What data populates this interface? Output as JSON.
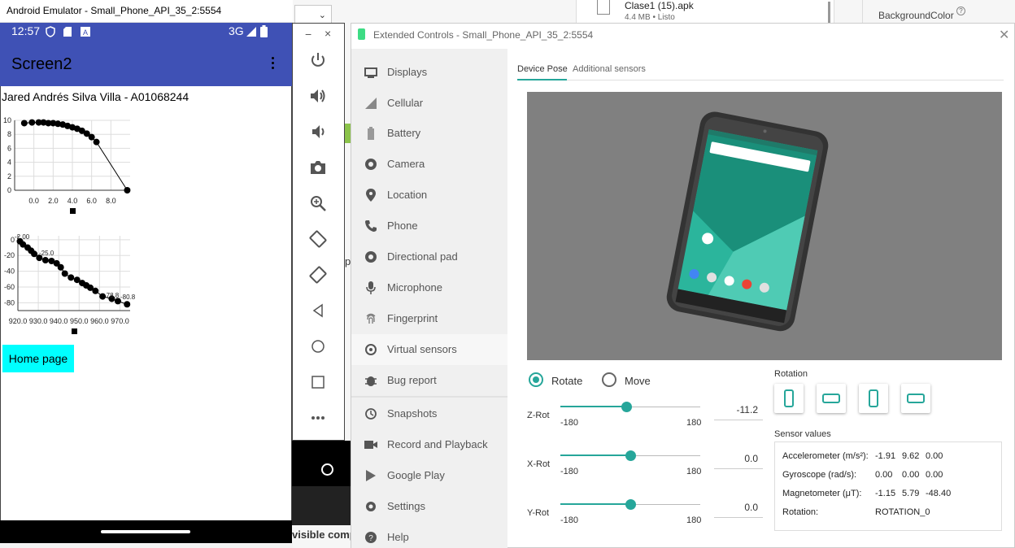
{
  "background": {
    "file_name": "Clase1 (15).apk",
    "file_meta": "4.4 MB • Listo",
    "property_label": "BackgroundColor",
    "help_glyph": "?",
    "partial_text": "visible comp",
    "partial_glyph": "p"
  },
  "emulator": {
    "window_title": "Android Emulator - Small_Phone_API_35_2:5554",
    "status": {
      "time": "12:57",
      "network": "3G"
    },
    "app": {
      "title": "Screen2",
      "author": "Jared Andrés Silva Villa - A01068244",
      "home_button": "Home page"
    }
  },
  "toolbar": {
    "minimize": "−",
    "close": "×",
    "buttons": [
      "power",
      "volume-up",
      "volume-down",
      "camera",
      "zoom",
      "rotate-left",
      "rotate-right",
      "back",
      "home",
      "overview",
      "more"
    ]
  },
  "extended_controls": {
    "title": "Extended Controls - Small_Phone_API_35_2:5554",
    "close": "✕",
    "sidebar": [
      {
        "label": "Displays",
        "icon": "display-icon"
      },
      {
        "label": "Cellular",
        "icon": "cellular-icon"
      },
      {
        "label": "Battery",
        "icon": "battery-icon"
      },
      {
        "label": "Camera",
        "icon": "camera-icon"
      },
      {
        "label": "Location",
        "icon": "location-icon"
      },
      {
        "label": "Phone",
        "icon": "phone-icon"
      },
      {
        "label": "Directional pad",
        "icon": "dpad-icon"
      },
      {
        "label": "Microphone",
        "icon": "microphone-icon"
      },
      {
        "label": "Fingerprint",
        "icon": "fingerprint-icon"
      },
      {
        "label": "Virtual sensors",
        "icon": "virtual-sensors-icon",
        "active": true
      },
      {
        "label": "Bug report",
        "icon": "bug-icon"
      },
      {
        "label": "Snapshots",
        "icon": "snapshots-icon"
      },
      {
        "label": "Record and Playback",
        "icon": "record-icon"
      },
      {
        "label": "Google Play",
        "icon": "google-play-icon"
      },
      {
        "label": "Settings",
        "icon": "settings-icon"
      },
      {
        "label": "Help",
        "icon": "help-icon"
      }
    ],
    "tabs": {
      "device_pose": "Device Pose",
      "additional_sensors": "Additional sensors"
    },
    "mode": {
      "rotate": "Rotate",
      "move": "Move",
      "selected": "rotate"
    },
    "sliders": [
      {
        "label": "Z-Rot",
        "min": "-180",
        "max": "180",
        "value": "-11.2",
        "fraction": 0.47
      },
      {
        "label": "X-Rot",
        "min": "-180",
        "max": "180",
        "value": "0.0",
        "fraction": 0.5
      },
      {
        "label": "Y-Rot",
        "min": "-180",
        "max": "180",
        "value": "0.0",
        "fraction": 0.5
      }
    ],
    "rotation_label": "Rotation",
    "sensor_values_label": "Sensor values",
    "sensors": [
      {
        "name": "Accelerometer (m/s²):",
        "values": [
          "-1.91",
          "9.62",
          "0.00"
        ]
      },
      {
        "name": "Gyroscope (rad/s):",
        "values": [
          "0.00",
          "0.00",
          "0.00"
        ]
      },
      {
        "name": "Magnetometer (μT):",
        "values": [
          "-1.15",
          "5.79",
          "-48.40"
        ]
      },
      {
        "name": "Rotation:",
        "values": [
          "ROTATION_0"
        ]
      }
    ],
    "accent": "#26a69a"
  },
  "chart_data": [
    {
      "type": "line",
      "x": [
        -1.0,
        -0.2,
        0.5,
        1.0,
        1.5,
        2.0,
        2.5,
        3.0,
        3.5,
        4.0,
        4.5,
        5.0,
        5.5,
        6.0,
        6.5,
        9.7
      ],
      "y": [
        9.6,
        9.7,
        9.7,
        9.7,
        9.6,
        9.6,
        9.5,
        9.4,
        9.2,
        9.0,
        8.8,
        8.5,
        8.1,
        7.6,
        6.9,
        0.0
      ],
      "xticks": [
        "0.0",
        "2.0",
        "4.0",
        "6.0",
        "8.0"
      ],
      "yticks": [
        "0",
        "2",
        "4",
        "6",
        "8",
        "10"
      ],
      "xlim": [
        -2,
        10
      ],
      "ylim": [
        0,
        10
      ],
      "grid": true,
      "legend": "bottom",
      "legend_text": ""
    },
    {
      "type": "line",
      "x": [
        921.0,
        922.5,
        924.8,
        926.5,
        928.0,
        930.5,
        933.5,
        936.5,
        939.0,
        941.0,
        943.0,
        946.0,
        949.0,
        951.5,
        953.5,
        955.5,
        958.0,
        961.5,
        966.0,
        969.0,
        973.5
      ],
      "y": [
        -2,
        -6,
        -10,
        -14,
        -18,
        -23,
        -26,
        -27,
        -30,
        -35,
        -43,
        -48,
        -51,
        -55,
        -58,
        -61,
        -65,
        -72,
        -75,
        -78,
        -82
      ],
      "labels": [
        "-2.00",
        "-25.0",
        "-78.8",
        "-80.8"
      ],
      "xticks": [
        "920.0",
        "930.0",
        "940.0",
        "950.0",
        "960.0",
        "970.0"
      ],
      "yticks": [
        "0",
        "-20",
        "-40",
        "-60",
        "-80"
      ],
      "xlim": [
        920,
        975
      ],
      "ylim": [
        -90,
        5
      ],
      "grid": true,
      "legend": "bottom",
      "legend_text": ""
    }
  ]
}
